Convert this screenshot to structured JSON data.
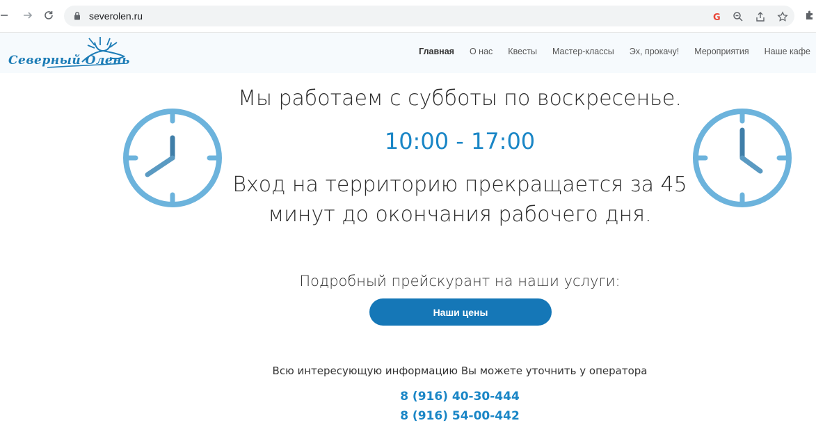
{
  "browser": {
    "url": "severolen.ru"
  },
  "site": {
    "logo_text": "Северный Олень",
    "menu": [
      {
        "label": "Главная",
        "active": true
      },
      {
        "label": "О нас"
      },
      {
        "label": "Квесты"
      },
      {
        "label": "Мастер-классы"
      },
      {
        "label": "Эх, прокачу!"
      },
      {
        "label": "Мероприятия"
      },
      {
        "label": "Наше кафе"
      }
    ]
  },
  "main": {
    "schedule_line": "Мы работаем с субботы по воскресенье.",
    "hours": "10:00 - 17:00",
    "entry_line_1": "Вход на территорию прекращается за 45",
    "entry_line_2": "минут до окончания рабочего дня.",
    "price_intro": "Подробный прейскурант на наши услуги:",
    "price_button": "Наши цены",
    "operator_text": "Всю интересующую информацию Вы можете уточнить у оператора",
    "phones": [
      "8 (916) 40-30-444",
      "8 (916) 54-00-442"
    ]
  },
  "colors": {
    "accent": "#1a86c6",
    "button": "#1577b7",
    "clock": "#6cb3dc"
  }
}
